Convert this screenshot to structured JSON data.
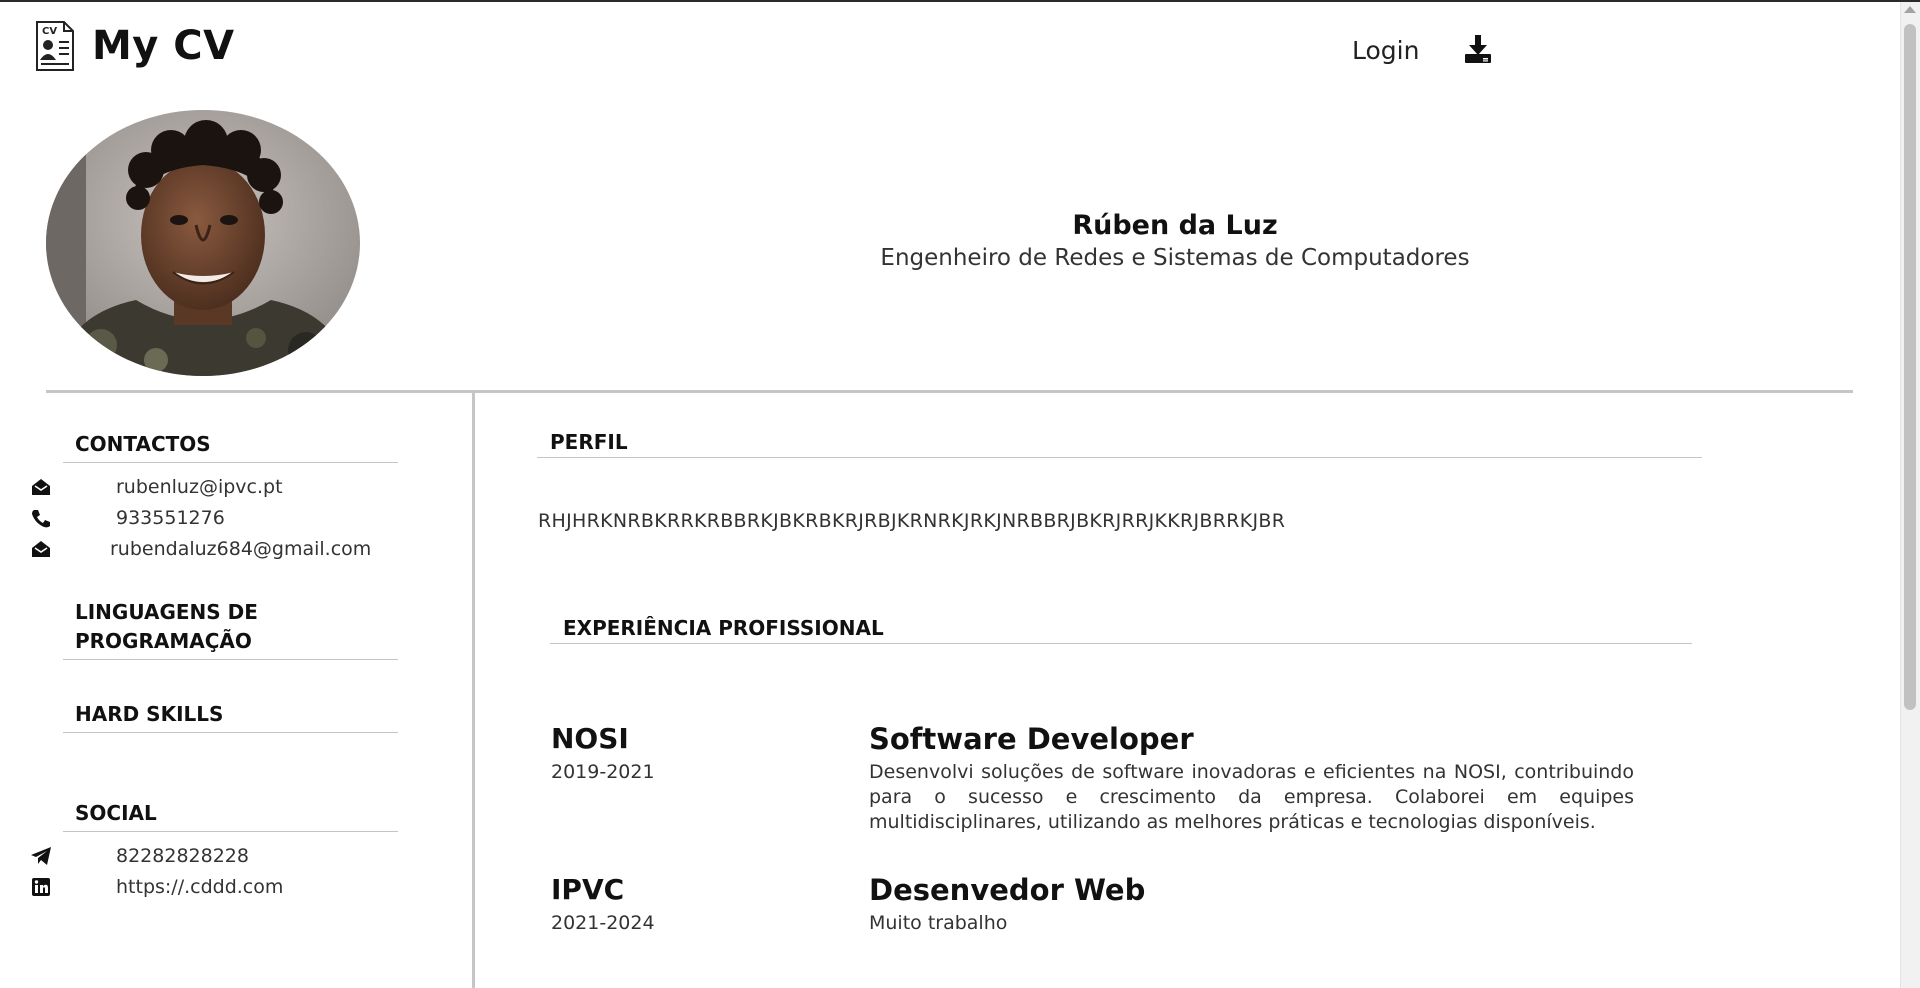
{
  "header": {
    "brand_icon_text": "CV",
    "title": "My CV",
    "login_label": "Login",
    "download_icon": "download-icon"
  },
  "profile": {
    "name": "Rúben da Luz",
    "role": "Engenheiro de Redes e Sistemas de Computadores"
  },
  "sidebar": {
    "contacts_heading": "CONTACTOS",
    "contacts": [
      {
        "icon": "envelope-open-icon",
        "text": "rubenluz@ipvc.pt"
      },
      {
        "icon": "phone-icon",
        "text": "933551276"
      },
      {
        "icon": "envelope-open-icon",
        "text": "rubendaluz684@gmail.com"
      }
    ],
    "languages_heading_line1": "LINGUAGENS DE",
    "languages_heading_line2": "PROGRAMAÇÃO",
    "hard_skills_heading": "HARD SKILLS",
    "social_heading": "SOCIAL",
    "social": [
      {
        "icon": "telegram-icon",
        "text": "82282828228"
      },
      {
        "icon": "linkedin-icon",
        "text": "https://.cddd.com"
      }
    ]
  },
  "main": {
    "profile_heading": "PERFIL",
    "profile_text": "RHJHRKNRBKRRKRBBRKJBKRBKRJRBJKRNRKJRKJNRBBRJBKRJRRJKKRJBRRKJBR",
    "experience_heading": "EXPERIÊNCIA PROFISSIONAL",
    "experience": [
      {
        "company": "NOSI",
        "years": "2019-2021",
        "title": "Software Developer",
        "description": "Desenvolvi soluções de software inovadoras e eficientes na NOSI, contribuindo para o sucesso e crescimento da empresa. Colaborei em equipes multidisciplinares, utilizando as melhores práticas e tecnologias disponíveis."
      },
      {
        "company": "IPVC",
        "years": "2021-2024",
        "title": "Desenvedor Web",
        "description": "Muito trabalho"
      }
    ]
  }
}
